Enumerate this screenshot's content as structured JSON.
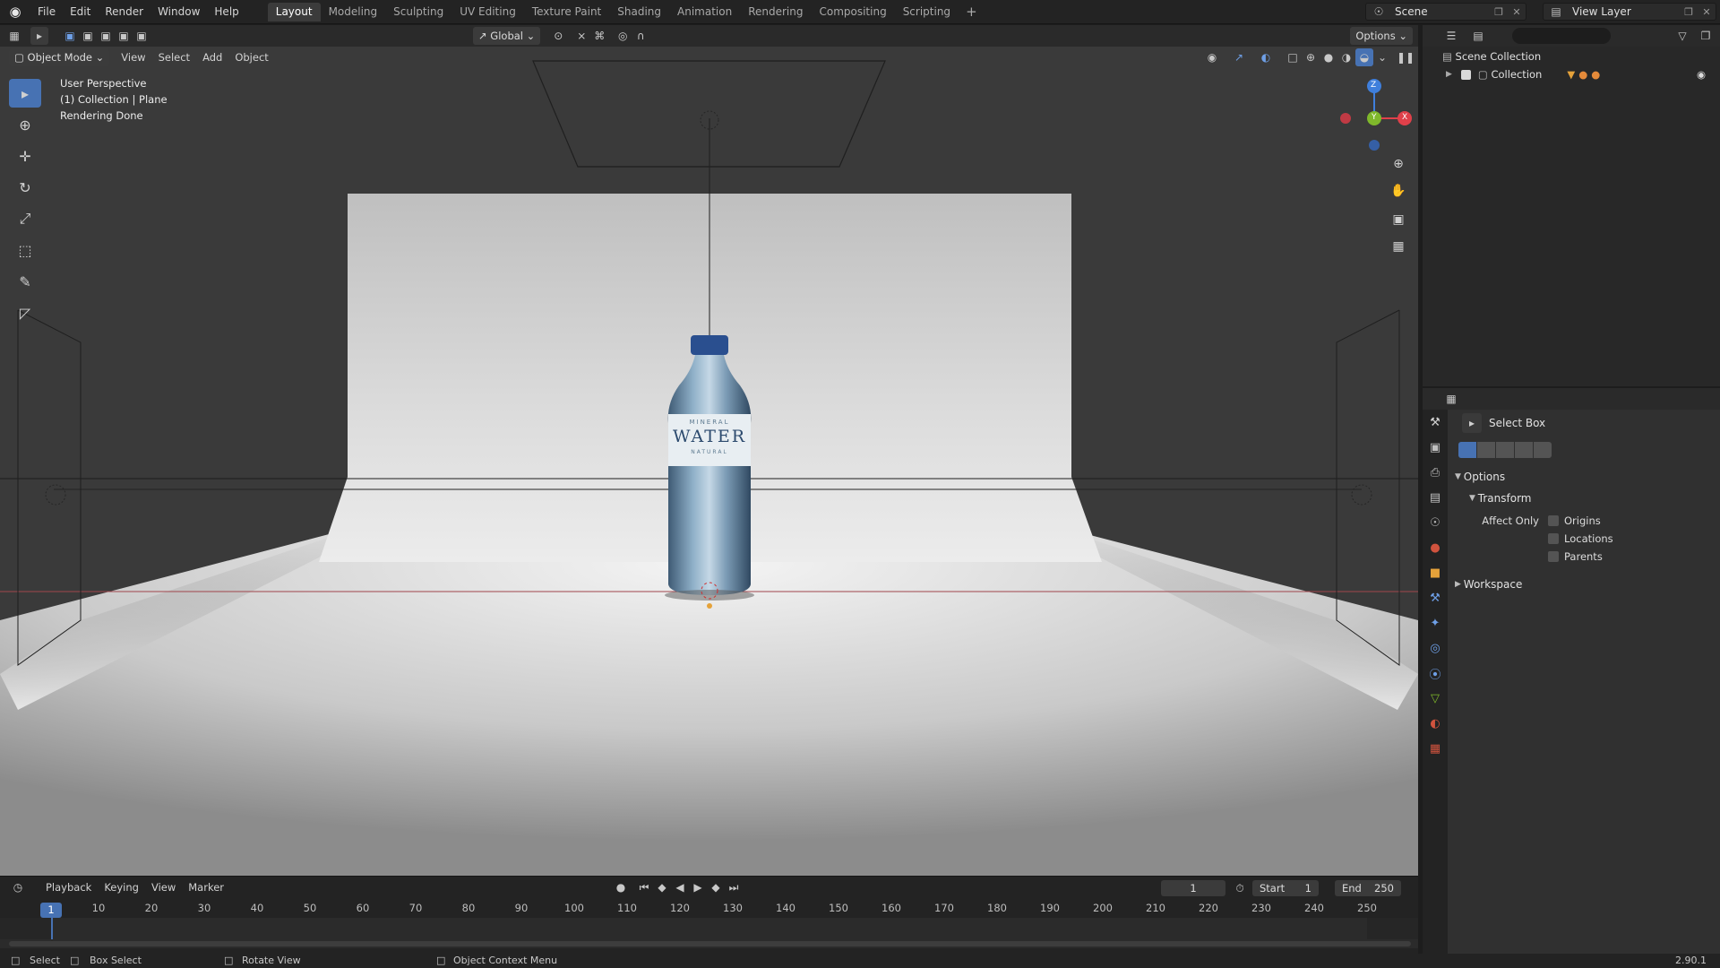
{
  "app": {
    "menu": [
      "File",
      "Edit",
      "Render",
      "Window",
      "Help"
    ],
    "workspaces": [
      "Layout",
      "Modeling",
      "Sculpting",
      "UV Editing",
      "Texture Paint",
      "Shading",
      "Animation",
      "Rendering",
      "Compositing",
      "Scripting"
    ],
    "active_workspace": "Layout",
    "add_tab": "+",
    "scene_name": "Scene",
    "view_layer": "View Layer",
    "version": "2.90.1"
  },
  "viewport_header": {
    "mode": "Object Mode",
    "menus": [
      "View",
      "Select",
      "Add",
      "Object"
    ],
    "orientation": "Global",
    "options_label": "Options"
  },
  "viewport": {
    "overlay_lines": [
      "User Perspective",
      "(1) Collection | Plane",
      "Rendering Done"
    ],
    "bottle_label_top": "MINERAL",
    "bottle_label_main": "WATER",
    "bottle_label_bottom": "NATURAL",
    "tools": [
      "select-box",
      "cursor",
      "move",
      "rotate",
      "scale",
      "transform",
      "annotate",
      "measure"
    ],
    "gizmo_axes": [
      "Z",
      "Y",
      "X"
    ],
    "colors": {
      "background": "#3a3a3a",
      "backdrop": "#d8d8d8",
      "accent": "#4772b3",
      "axis_x": "#e0404a",
      "axis_y": "#7fb82b",
      "axis_z": "#3f7fdc"
    }
  },
  "timeline": {
    "menus": [
      "Playback",
      "Keying",
      "View",
      "Marker"
    ],
    "current_frame": "1",
    "start_label": "Start",
    "start": "1",
    "end_label": "End",
    "end": "250",
    "ticks": [
      "10",
      "20",
      "30",
      "40",
      "50",
      "60",
      "70",
      "80",
      "90",
      "100",
      "110",
      "120",
      "130",
      "140",
      "150",
      "160",
      "170",
      "180",
      "190",
      "200",
      "210",
      "220",
      "230",
      "240",
      "250"
    ]
  },
  "statusbar": {
    "select": "Select",
    "box_select": "Box Select",
    "rotate_view": "Rotate View",
    "context_menu": "Object Context Menu"
  },
  "outliner": {
    "search_placeholder": "",
    "scene_collection": "Scene Collection",
    "collection": "Collection"
  },
  "properties": {
    "tool_name": "Select Box",
    "options": "Options",
    "transform": "Transform",
    "affect_only": "Affect Only",
    "origins": "Origins",
    "locations": "Locations",
    "parents": "Parents",
    "workspace": "Workspace"
  }
}
